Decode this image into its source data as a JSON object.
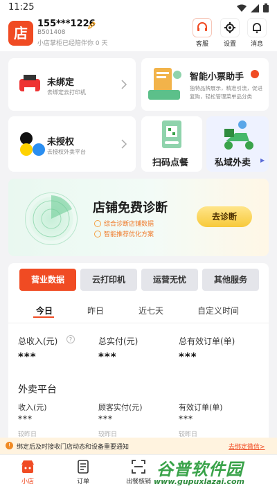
{
  "status": {
    "time": "11:25"
  },
  "header": {
    "logo_text": "店",
    "account": "155***1226",
    "store_id": "B501408",
    "companion": "小店掌柜已经陪伴你 0 天",
    "buttons": [
      {
        "label": "客服"
      },
      {
        "label": "设置"
      },
      {
        "label": "消息"
      }
    ]
  },
  "cards": {
    "printer": {
      "title": "未绑定",
      "sub": "去绑定云打印机"
    },
    "ticket": {
      "title": "智能小票助手",
      "sub_line1": "独特品牌展示，精准引流，促进",
      "sub_line2": "复购，轻松管理菜单品分类"
    },
    "delivery": {
      "title": "未授权",
      "sub": "去授权外卖平台"
    },
    "scan": {
      "title": "扫码点餐"
    },
    "private": {
      "title": "私域外卖"
    }
  },
  "diagnosis": {
    "title": "店铺免费诊断",
    "line1": "综合诊断店铺数据",
    "line2": "智能推荐优化方案",
    "button": "去诊断"
  },
  "segments": [
    {
      "label": "营业数据"
    },
    {
      "label": "云打印机"
    },
    {
      "label": "运营无忧"
    },
    {
      "label": "其他服务"
    }
  ],
  "date_tabs": [
    {
      "label": "今日"
    },
    {
      "label": "昨日"
    },
    {
      "label": "近七天"
    },
    {
      "label": "自定义时间"
    }
  ],
  "metrics": {
    "total_income": {
      "label": "总收入(元)",
      "value": "***"
    },
    "total_paid": {
      "label": "总实付(元)",
      "value": "***"
    },
    "total_orders": {
      "label": "总有效订单(单)",
      "value": "***"
    }
  },
  "takeout": {
    "title": "外卖平台",
    "income": {
      "label": "收入(元)",
      "value": "***"
    },
    "customer_paid": {
      "label": "顾客实付(元)",
      "value": "***"
    },
    "orders": {
      "label": "有效订单(单)",
      "value": "***"
    },
    "compare_label": "较昨日"
  },
  "notice": {
    "text": "绑定后及时接收门店动态和设备重要通知",
    "link": "去绑定微信>"
  },
  "tabbar": [
    {
      "label": "小店"
    },
    {
      "label": "订单"
    },
    {
      "label": "出餐核销"
    }
  ],
  "watermark": {
    "line1": "谷普软件园",
    "line2": "www.gupuxlazai.com"
  },
  "colors": {
    "accent": "#f04b23",
    "diagnose_button": "#f7c93a",
    "green": "#3aa34a"
  }
}
